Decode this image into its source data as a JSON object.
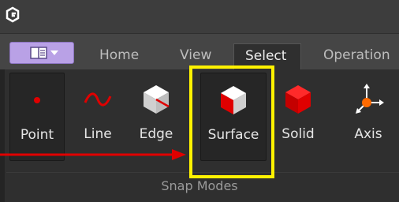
{
  "app": {
    "logo_icon": "cubic-logo-icon"
  },
  "app_menu": {
    "icon": "book-icon"
  },
  "tabs": [
    {
      "label": "Home"
    },
    {
      "label": "View"
    },
    {
      "label": "Select",
      "active": true
    },
    {
      "label": "Operation"
    }
  ],
  "ribbon": {
    "group_label": "Snap Modes",
    "tools": [
      {
        "label": "Point",
        "icon": "point-icon",
        "pressed": true
      },
      {
        "label": "Line",
        "icon": "line-icon"
      },
      {
        "label": "Edge",
        "icon": "edge-icon"
      },
      {
        "label": "Surface",
        "icon": "surface-icon",
        "pressed": true,
        "highlighted": true
      },
      {
        "label": "Solid",
        "icon": "solid-icon"
      },
      {
        "label": "Axis",
        "icon": "axis-icon"
      }
    ]
  },
  "annotation": {
    "highlight_color": "#fff200",
    "arrow_color": "#e00000"
  }
}
